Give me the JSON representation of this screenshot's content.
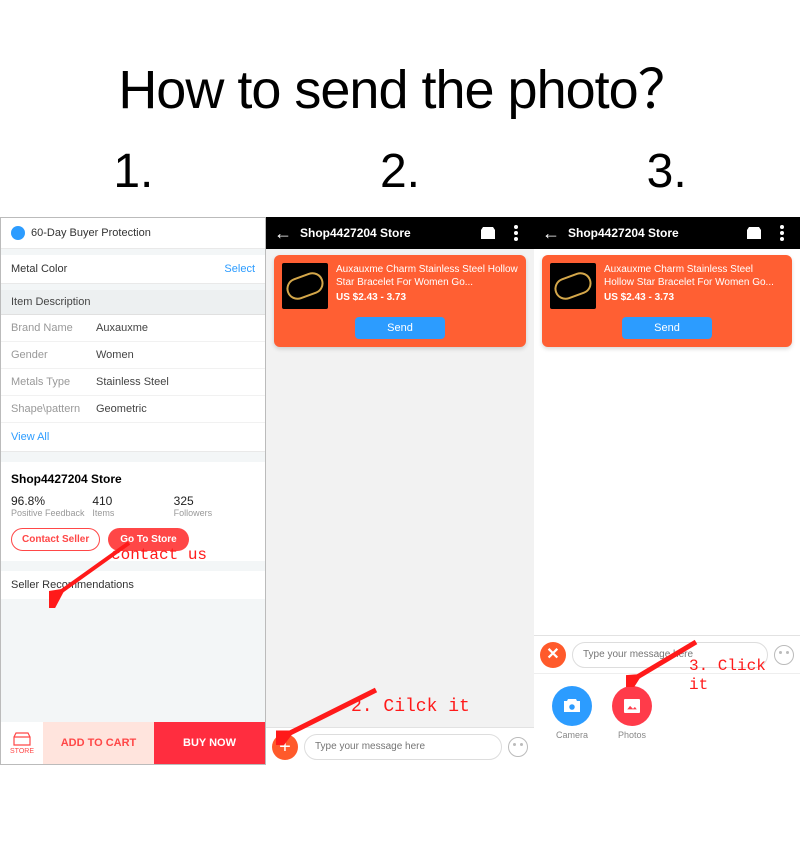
{
  "title": "How to send the photo",
  "question_mark": "？",
  "steps": [
    "1.",
    "2.",
    "3."
  ],
  "col1": {
    "protection": "60-Day Buyer Protection",
    "metal_color_label": "Metal Color",
    "select_label": "Select",
    "item_desc_header": "Item Description",
    "specs": [
      {
        "k": "Brand Name",
        "v": "Auxauxme"
      },
      {
        "k": "Gender",
        "v": "Women"
      },
      {
        "k": "Metals Type",
        "v": "Stainless Steel"
      },
      {
        "k": "Shape\\pattern",
        "v": "Geometric"
      }
    ],
    "view_all": "View All",
    "store_name": "Shop4427204 Store",
    "metrics": [
      {
        "val": "96.8%",
        "lbl": "Positive Feedback"
      },
      {
        "val": "410",
        "lbl": "Items"
      },
      {
        "val": "325",
        "lbl": "Followers"
      }
    ],
    "contact_btn": "Contact Seller",
    "goto_btn": "Go To Store",
    "seller_rec": "Seller Recommendations",
    "bb_store": "STORE",
    "bb_add": "ADD TO CART",
    "bb_buy": "BUY NOW",
    "anno": "contact us"
  },
  "chat": {
    "app_title": "Shop4427204 Store",
    "product_title": "Auxauxme Charm Stainless Steel Hollow Star Bracelet For Women Go...",
    "product_price": "US $2.43 - 3.73",
    "send": "Send",
    "placeholder": "Type your message here"
  },
  "col2": {
    "anno": "2. Cilck it"
  },
  "col3": {
    "camera_label": "Camera",
    "photos_label": "Photos",
    "anno": "3. Click it"
  }
}
